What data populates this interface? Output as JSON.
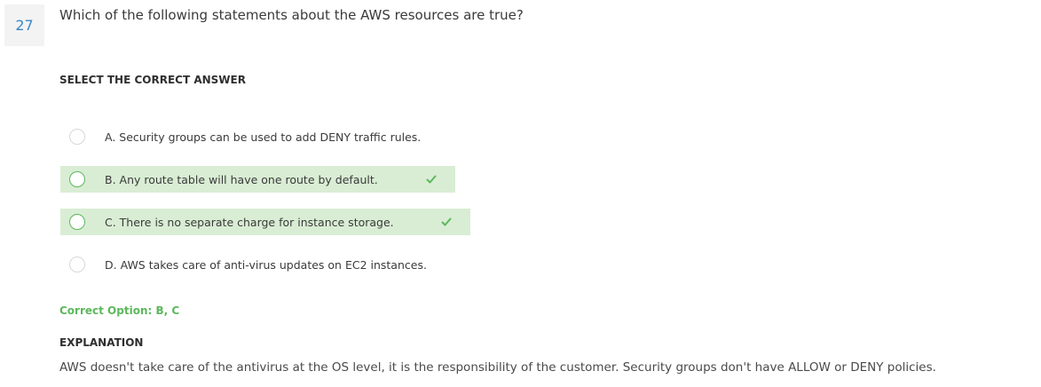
{
  "question": {
    "number": "27",
    "text": "Which of the following statements about the AWS resources are true?"
  },
  "select_label": "SELECT THE CORRECT ANSWER",
  "options": [
    {
      "label": "A. Security groups can be used to add DENY traffic rules.",
      "correct": false
    },
    {
      "label": "B. Any route table will have one route by default.",
      "correct": true,
      "check_icon": "checkmark-icon"
    },
    {
      "label": "C. There is no separate charge for instance storage.",
      "correct": true,
      "check_icon": "checkmark-icon"
    },
    {
      "label": "D. AWS takes care of anti-virus updates on EC2 instances.",
      "correct": false
    }
  ],
  "result": {
    "correct_option": "Correct Option: B, C"
  },
  "explanation": {
    "heading": "EXPLANATION",
    "text": "AWS doesn't take care of the antivirus at the OS level, it is the responsibility of the customer. Security groups don't have ALLOW or DENY policies."
  },
  "colors": {
    "accent_blue": "#3b87c8",
    "correct_green": "#5cb85c",
    "correct_bg": "#d9edd4"
  }
}
